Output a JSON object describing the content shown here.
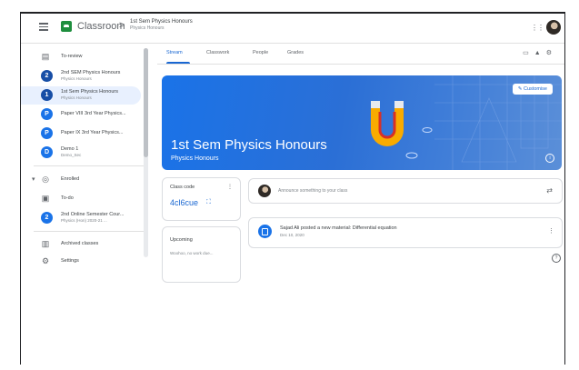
{
  "topbar": {
    "brand": "Classroom",
    "separator": ">",
    "class_title": "1st Sem Physics Honours",
    "class_subtitle": "Physics Honours",
    "apps_label": "⋮⋮"
  },
  "sidebar": {
    "items": [
      {
        "label": "To-review",
        "sub": "",
        "icon": "todo-review-icon"
      },
      {
        "label": "2nd SEM Physics Honours",
        "sub": "Physics Honours",
        "initial": "2"
      },
      {
        "label": "1st Sem Physics Honours",
        "sub": "Physics Honours",
        "initial": "1"
      },
      {
        "label": "Paper VIII 3rd Year Physics...",
        "sub": "",
        "initial": "P"
      },
      {
        "label": "Paper IX 3rd Year Physics...",
        "sub": "",
        "initial": "P"
      },
      {
        "label": "Demo 1",
        "sub": "Demo_Sec",
        "initial": "D"
      },
      {
        "label": "Enrolled",
        "sub": "",
        "icon": "enrolled-icon"
      },
      {
        "label": "To-do",
        "sub": "",
        "icon": "todo-icon"
      },
      {
        "label": "2nd Online Semester Cour...",
        "sub": "Physics (Hon) 2020-21 ...",
        "initial": "2"
      },
      {
        "label": "Archived classes",
        "sub": "",
        "icon": "archive-icon"
      },
      {
        "label": "Settings",
        "sub": "",
        "icon": "gear-icon"
      }
    ]
  },
  "tabs": [
    {
      "label": "Stream"
    },
    {
      "label": "Classwork"
    },
    {
      "label": "People"
    },
    {
      "label": "Grades"
    }
  ],
  "banner": {
    "title": "1st Sem Physics Honours",
    "subtitle": "Physics Honours",
    "customise_label": "Customise",
    "info": "i"
  },
  "class_code": {
    "label": "Class code",
    "value": "4cl6cue",
    "more": "⋮",
    "expand": "⛶"
  },
  "upcoming": {
    "label": "Upcoming",
    "text": "Woohoo, no work due..."
  },
  "announce": {
    "placeholder": "Announce something to your class",
    "repost": "⇄"
  },
  "post": {
    "title": "Sajad Ali posted a new material: Differential equation",
    "date": "Dec 10, 2020",
    "more": "⋮"
  },
  "help": "?",
  "colors": {
    "accent": "#1967d2",
    "banner": "#1a73e8",
    "brand_green": "#1e8e3e"
  }
}
